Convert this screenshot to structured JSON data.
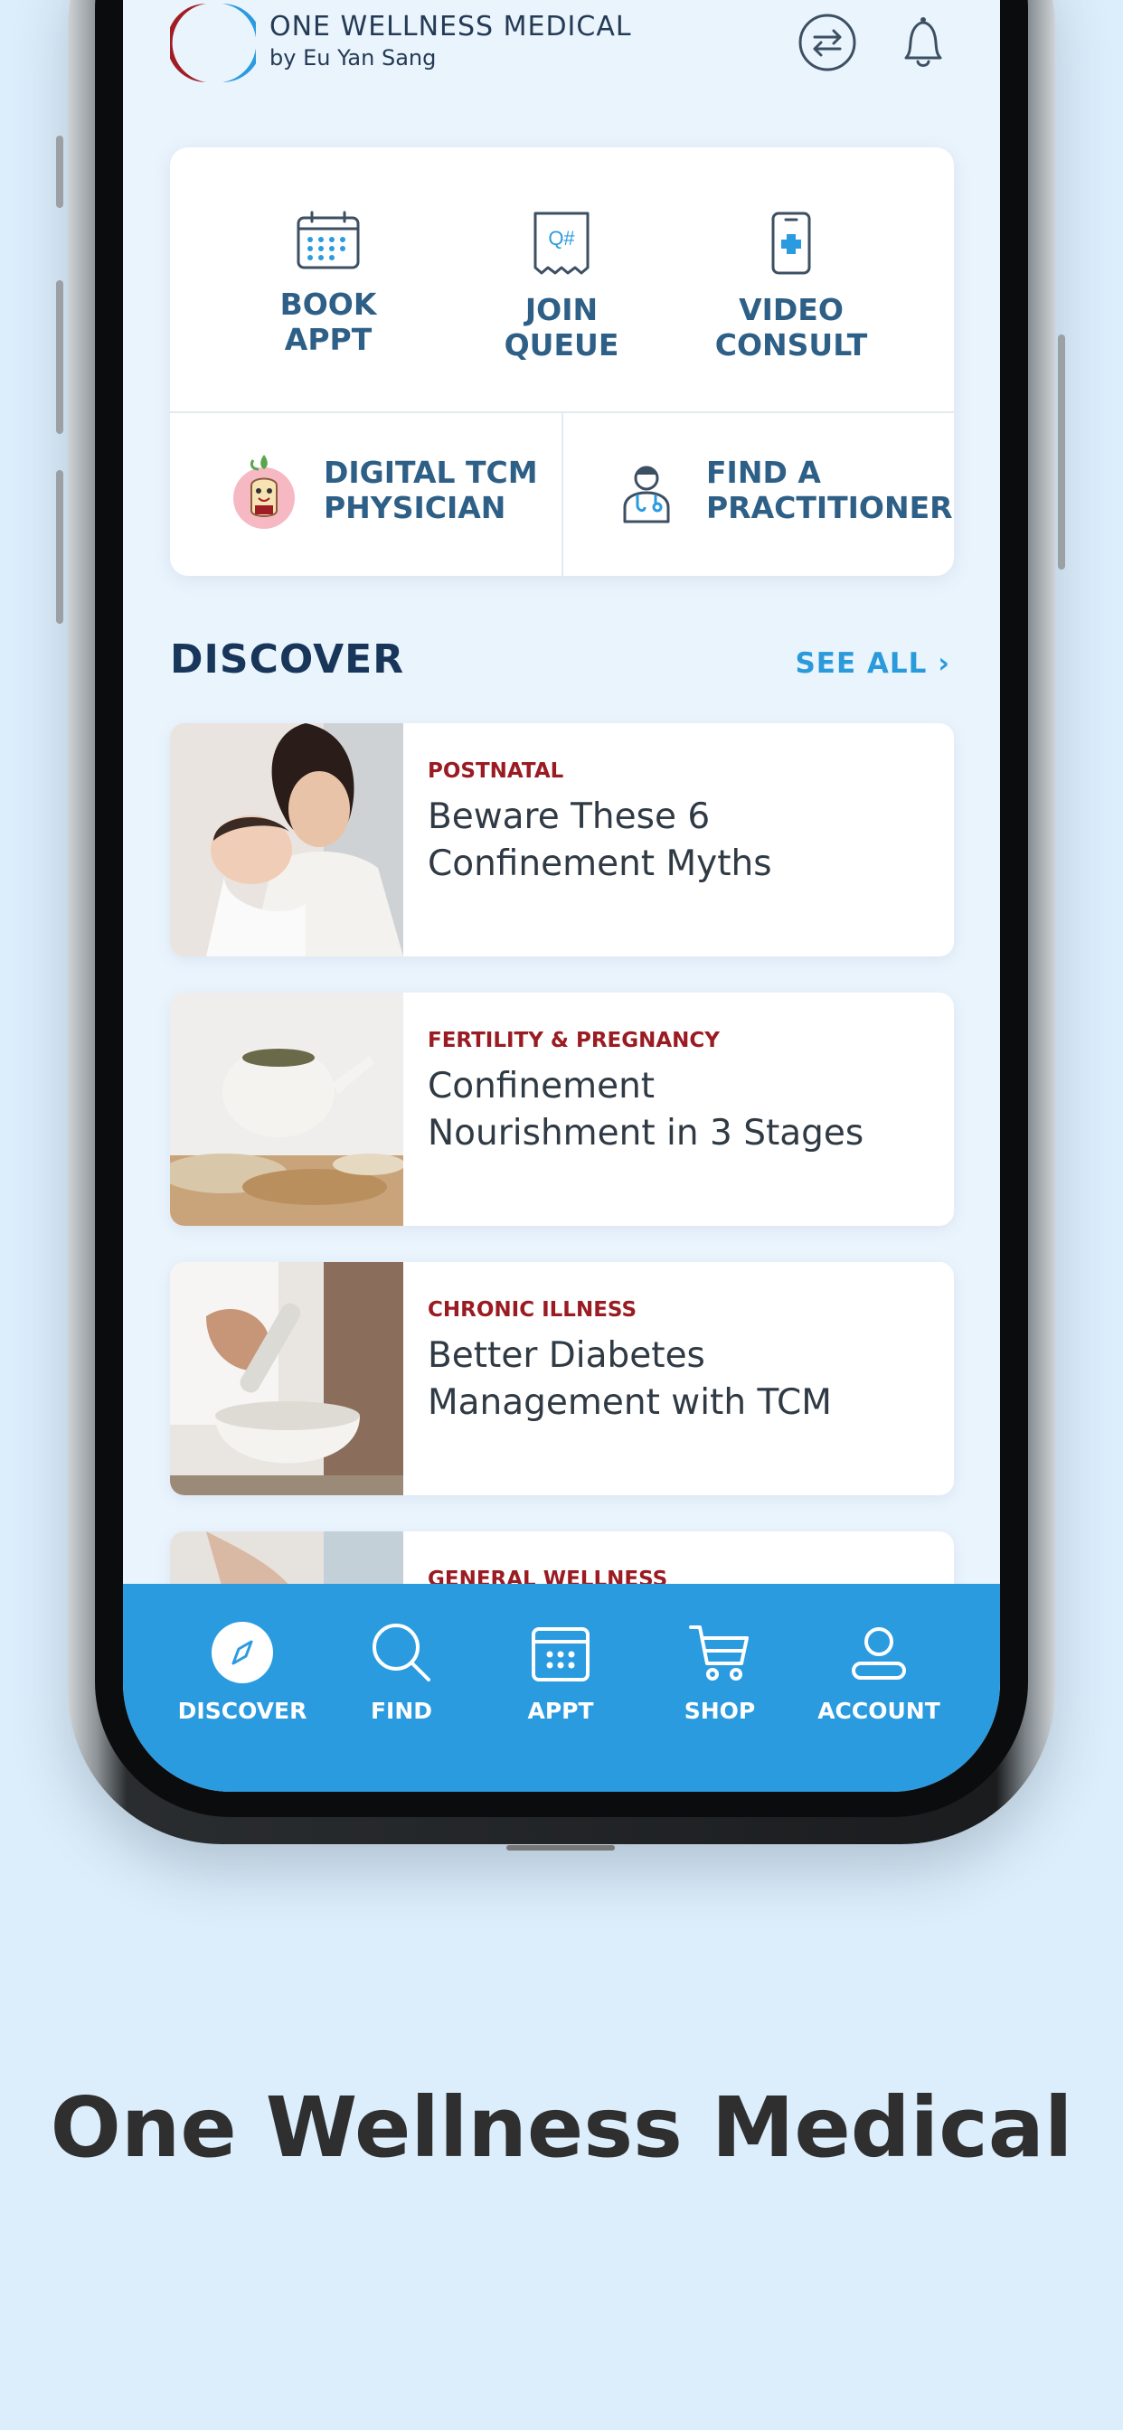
{
  "header": {
    "brand_title": "ONE WELLNESS MEDICAL",
    "brand_sub": "by Eu Yan Sang",
    "switch_icon": "switch-arrows-icon",
    "bell_icon": "bell-icon"
  },
  "actions": {
    "book": "BOOK\nAPPT",
    "queue": "JOIN\nQUEUE",
    "video": "VIDEO\nCONSULT",
    "digital": "DIGITAL TCM\nPHYSICIAN",
    "practitioner": "FIND A\nPRACTITIONER",
    "queue_icon_text": "Q#"
  },
  "discover": {
    "title": "DISCOVER",
    "see_all": "SEE ALL ›",
    "articles": [
      {
        "category": "POSTNATAL",
        "title": "Beware These 6\nConfinement Myths"
      },
      {
        "category": "FERTILITY & PREGNANCY",
        "title": "Confinement\nNourishment in 3 Stages"
      },
      {
        "category": "CHRONIC ILLNESS",
        "title": "Better Diabetes\nManagement with TCM"
      },
      {
        "category": "GENERAL WELLNESS",
        "title": ""
      }
    ]
  },
  "nav": {
    "discover": "DISCOVER",
    "find": "FIND",
    "appt": "APPT",
    "shop": "SHOP",
    "account": "ACCOUNT"
  },
  "caption": "One Wellness Medical",
  "colors": {
    "accent": "#2b9be0",
    "brand_navy": "#17365a",
    "category_red": "#9a1c22",
    "background": "#dcedfb"
  }
}
